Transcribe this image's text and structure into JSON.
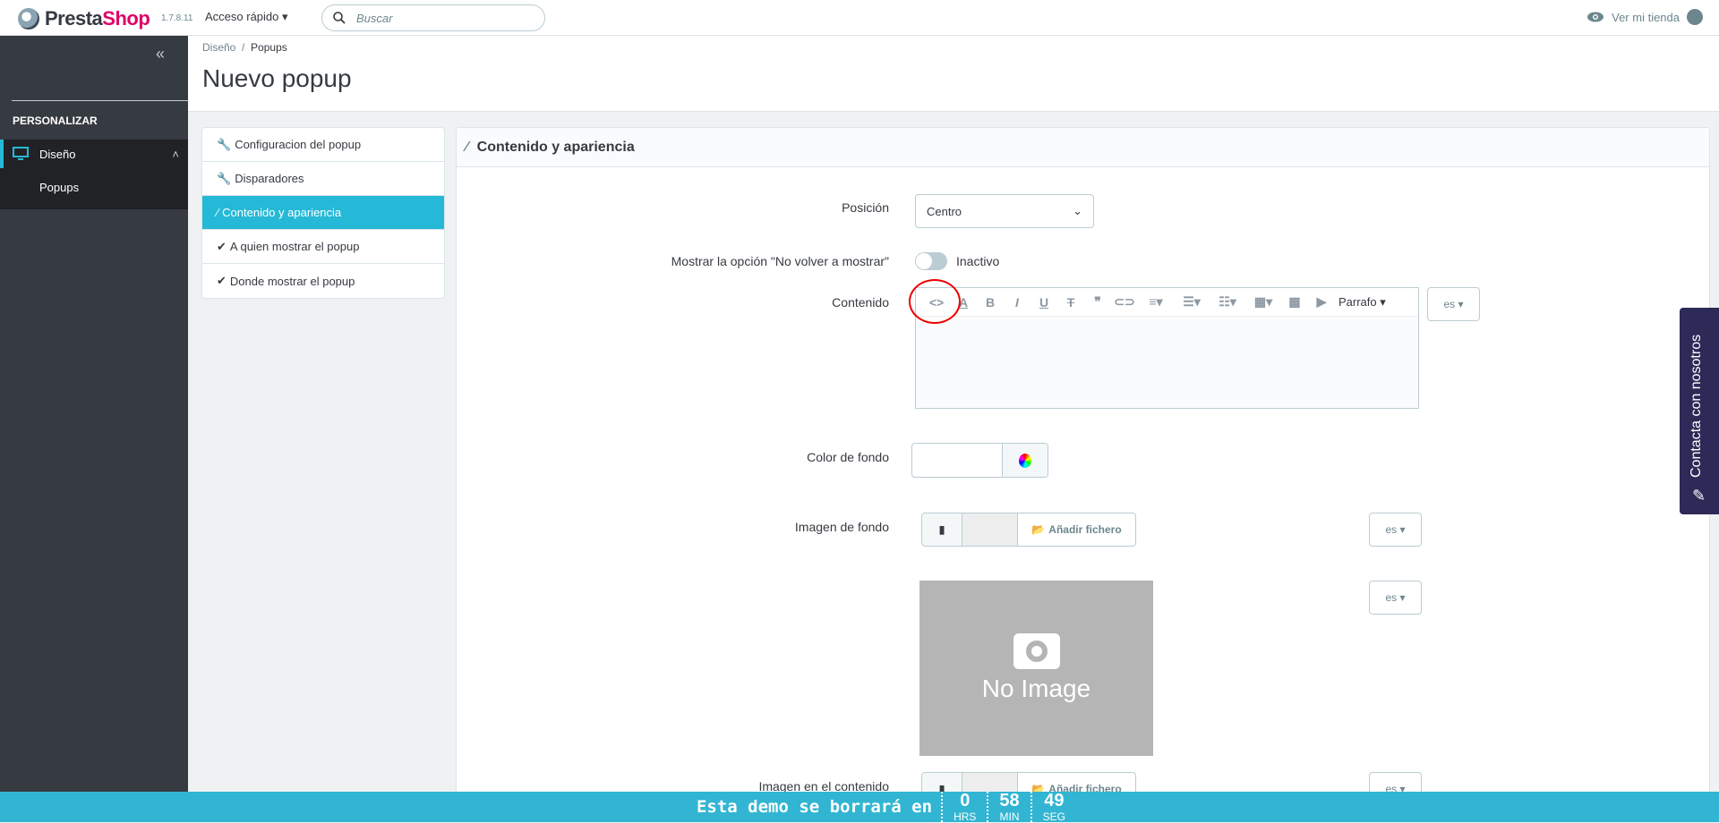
{
  "header": {
    "brand_a": "Presta",
    "brand_b": "Shop",
    "version": "1.7.8.11",
    "quick_access": "Acceso rápido",
    "search_placeholder": "Buscar",
    "view_shop": "Ver mi tienda"
  },
  "sidebar": {
    "section": "PERSONALIZAR",
    "item": "Diseño",
    "subitem": "Popups"
  },
  "breadcrumb": {
    "parent": "Diseño",
    "sep": "/",
    "current": "Popups"
  },
  "page_title": "Nuevo popup",
  "tabs": [
    {
      "label": "Configuracion del popup",
      "icon": "wrench-icon"
    },
    {
      "label": "Disparadores",
      "icon": "wrench-icon"
    },
    {
      "label": "Contenido y apariencia",
      "icon": "magic-wand-icon",
      "active": true
    },
    {
      "label": "A quien mostrar el popup",
      "icon": "check-icon"
    },
    {
      "label": "Donde mostrar el popup",
      "icon": "check-icon"
    }
  ],
  "panel": {
    "title": "Contenido y apariencia",
    "position_label": "Posición",
    "position_value": "Centro",
    "dont_show_label": "Mostrar la opción \"No volver a mostrar\"",
    "dont_show_state": "Inactivo",
    "content_label": "Contenido",
    "paragraph": "Parrafo",
    "lang": "es",
    "bg_color_label": "Color de fondo",
    "bg_image_label": "Imagen de fondo",
    "add_file": "Añadir fichero",
    "no_image": "No Image",
    "content_image_label": "Imagen en el contenido"
  },
  "contact": "Contacta con nosotros",
  "demo_bar": {
    "message": "Esta demo se borrará en",
    "hours": "0",
    "hours_lbl": "HRS",
    "minutes": "58",
    "minutes_lbl": "MIN",
    "seconds": "49",
    "seconds_lbl": "SEG"
  },
  "colors": {
    "accent": "#25b9d7",
    "sidebar": "#363a41",
    "bar": "#31b5d2",
    "brand_pink": "#df0067"
  }
}
